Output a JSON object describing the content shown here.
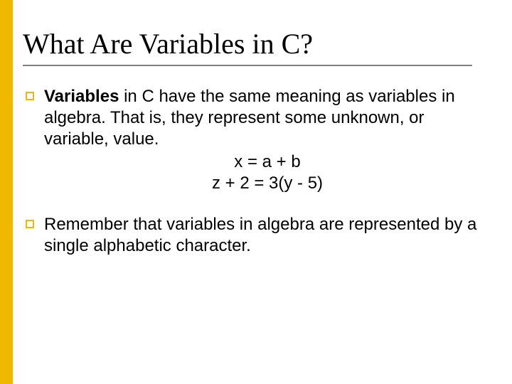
{
  "title": "What Are Variables in C?",
  "bullets": [
    {
      "bold": "Variables",
      "rest": " in C have the same meaning as variables in algebra.  That is, they represent some unknown, or variable, value.",
      "equations": [
        "x = a + b",
        "z + 2 = 3(y - 5)"
      ]
    },
    {
      "bold": "",
      "rest": "Remember that variables in algebra are represented by a single alphabetic character.",
      "equations": []
    }
  ]
}
